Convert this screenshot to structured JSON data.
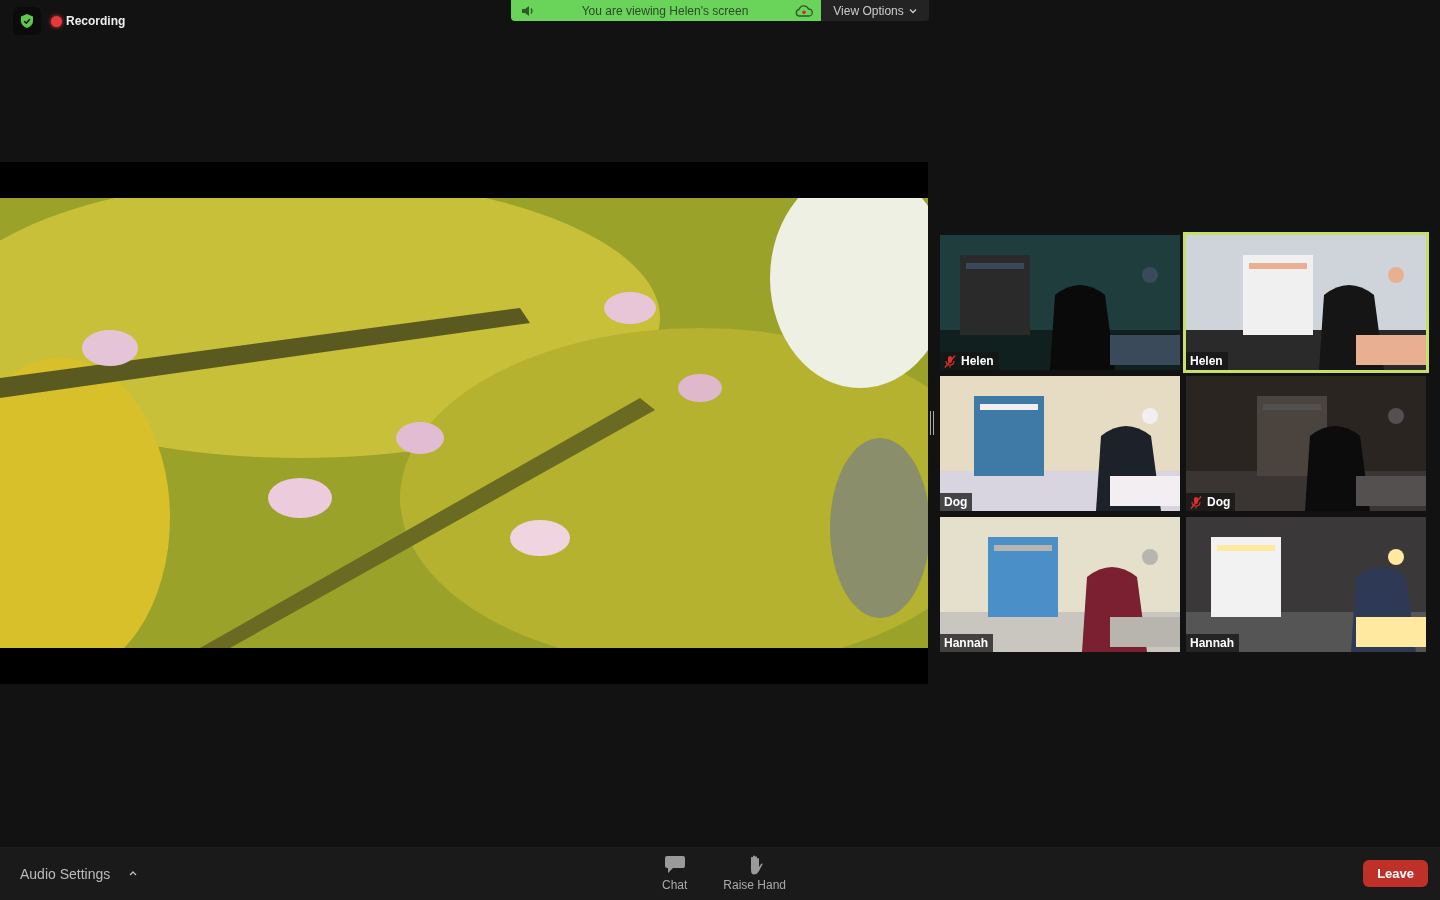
{
  "top_bar": {
    "recording_label": "Recording"
  },
  "share_banner": {
    "message": "You are viewing Helen's screen",
    "view_options": "View Options"
  },
  "participants": [
    {
      "name": "Helen",
      "muted": true,
      "speaking": false
    },
    {
      "name": "Helen",
      "muted": false,
      "speaking": true
    },
    {
      "name": "Dog",
      "muted": false,
      "speaking": false
    },
    {
      "name": "Dog",
      "muted": true,
      "speaking": false
    },
    {
      "name": "Hannah",
      "muted": false,
      "speaking": false
    },
    {
      "name": "Hannah",
      "muted": false,
      "speaking": false
    }
  ],
  "toolbar": {
    "audio_settings": "Audio Settings",
    "buttons": [
      {
        "kind": "chat",
        "label": "Chat"
      },
      {
        "kind": "hand",
        "label": "Raise Hand"
      }
    ],
    "leave": "Leave"
  }
}
